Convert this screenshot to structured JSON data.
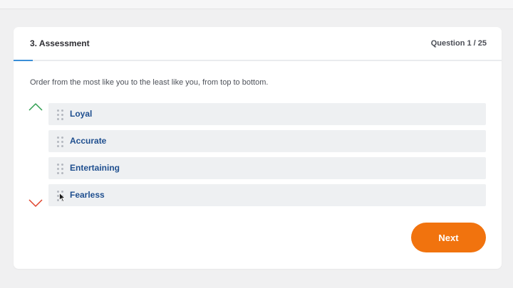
{
  "header": {
    "title": "3. Assessment",
    "question_counter": "Question 1 / 25",
    "progress_fraction": 0.04
  },
  "instruction": "Order from the most like you to the least like you, from top to bottom.",
  "options": [
    {
      "label": "Loyal"
    },
    {
      "label": "Accurate"
    },
    {
      "label": "Entertaining"
    },
    {
      "label": "Fearless"
    }
  ],
  "ranking_arrow": {
    "top_color": "#2e9e4f",
    "bottom_color": "#e0412a"
  },
  "next_button": {
    "label": "Next",
    "color": "#f1730e"
  },
  "accent_color": "#3a8ed8",
  "option_text_color": "#1f4f8f"
}
